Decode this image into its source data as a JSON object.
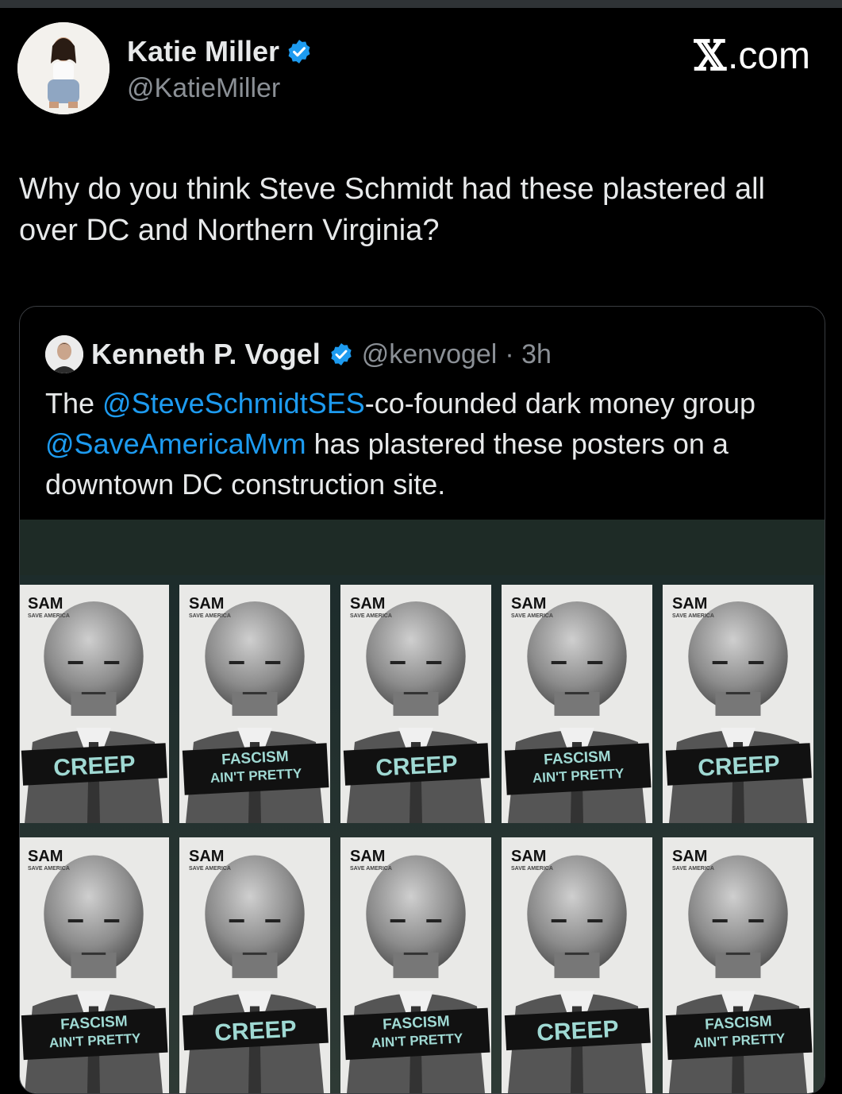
{
  "post": {
    "author": {
      "name": "Katie Miller",
      "handle": "@KatieMiller",
      "verified_icon": "verified-badge-icon"
    },
    "brand": {
      "glyph": "𝕏",
      "suffix": ".com"
    },
    "text": "Why do you think Steve Schmidt had these plastered all over DC and Northern Virginia?"
  },
  "quote": {
    "author": {
      "name": "Kenneth P. Vogel",
      "handle": "@kenvogel",
      "time": "· 3h",
      "verified_icon": "verified-badge-icon"
    },
    "text_parts": {
      "prefix": "The ",
      "mention1": "@SteveSchmidtSES",
      "middle": "-co-founded dark money group ",
      "mention2": "@SaveAmericaMvm",
      "suffix": " has plastered these posters on a downtown DC construction site."
    },
    "photo": {
      "poster_logo": "SAM",
      "poster_logo_sub": "SAVE AMERICA",
      "posters_row1": [
        "CREEP",
        "FASCISM|AIN'T PRETTY",
        "CREEP",
        "FASCISM|AIN'T PRETTY",
        "CREEP"
      ],
      "posters_row2": [
        "FASCISM|AIN'T PRETTY",
        "CREEP",
        "FASCISM|AIN'T PRETTY",
        "CREEP",
        "FASCISM|AIN'T PRETTY"
      ]
    }
  },
  "colors": {
    "accent": "#1d9bf0",
    "background": "#000000",
    "text": "#e7e9ea",
    "muted": "#8b9096",
    "poster_label": "#9fd9d3"
  }
}
